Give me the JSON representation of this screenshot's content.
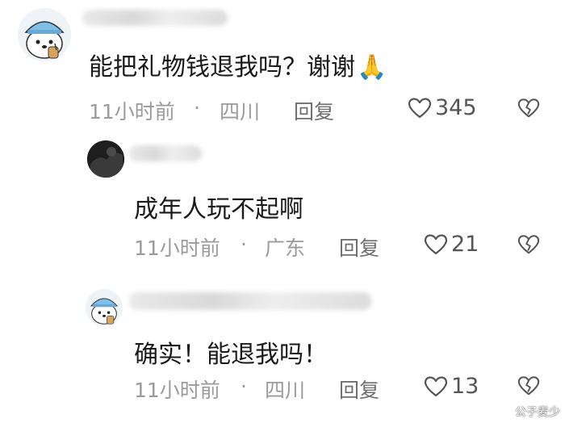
{
  "comments": [
    {
      "text": "能把礼物钱退我吗？谢谢",
      "emoji": "🙏",
      "time": "11小时前",
      "location": "四川",
      "reply_label": "回复",
      "likes": "345"
    },
    {
      "text": "成年人玩不起啊",
      "time": "11小时前",
      "location": "广东",
      "reply_label": "回复",
      "likes": "21"
    },
    {
      "text": "确实！能退我吗！",
      "time": "11小时前",
      "location": "四川",
      "reply_label": "回复",
      "likes": "13"
    }
  ],
  "separator": "·",
  "watermark": {
    "text": "公子麦少"
  },
  "colors": {
    "text": "#1a1a1a",
    "meta": "#9b9b9b",
    "background": "#ffffff"
  }
}
